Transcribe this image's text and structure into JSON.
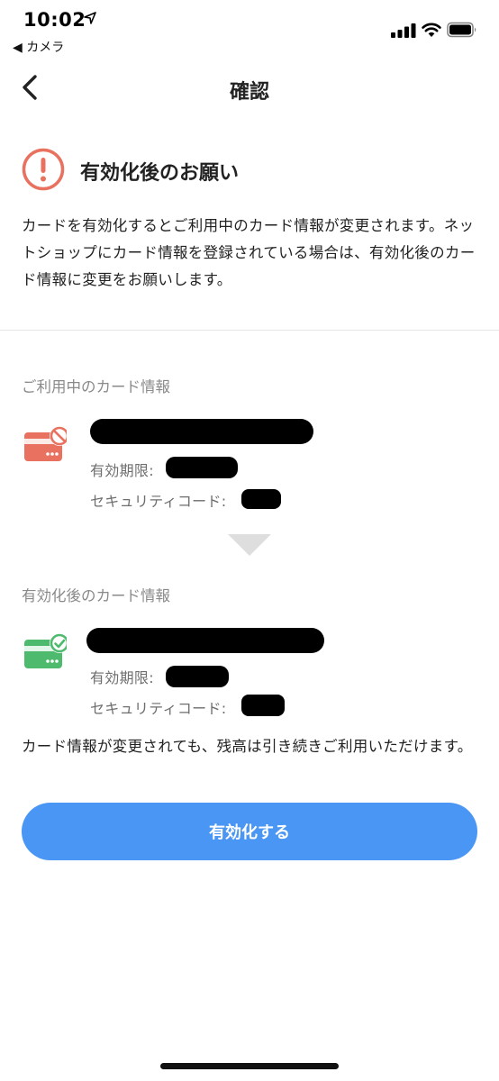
{
  "status_bar": {
    "time": "10:02",
    "back_app": "◀ カメラ"
  },
  "nav": {
    "title": "確認"
  },
  "notice": {
    "title": "有効化後のお願い",
    "body": "カードを有効化するとご利用中のカード情報が変更されます。ネットショップにカード情報を登録されている場合は、有効化後のカード情報に変更をお願いします。"
  },
  "current_card": {
    "section_label": "ご利用中のカード情報",
    "expiry_label": "有効期限:",
    "security_label": "セキュリティコード:"
  },
  "new_card": {
    "section_label": "有効化後のカード情報",
    "expiry_label": "有効期限:",
    "security_label": "セキュリティコード:"
  },
  "footer_note": "カード情報が変更されても、残高は引き続きご利用いただけます。",
  "activate_button": "有効化する",
  "colors": {
    "accent": "#4a96f5",
    "warning": "#e8715f",
    "success": "#4dba6e",
    "label_gray": "#8a8a8a"
  },
  "icons": {
    "back": "chevron-left-icon",
    "warning": "exclamation-circle-icon",
    "current_card": "card-blocked-icon",
    "new_card": "card-check-icon",
    "transition": "triangle-down-icon"
  }
}
